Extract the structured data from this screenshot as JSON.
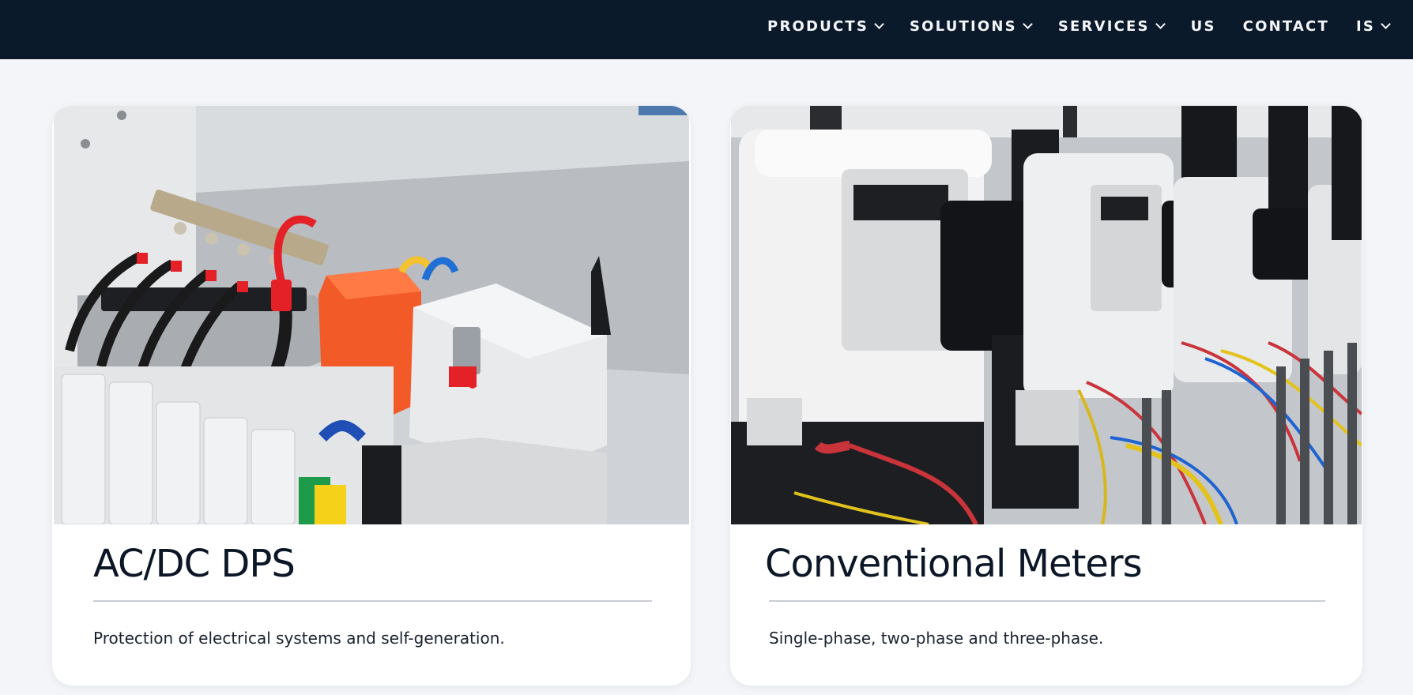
{
  "nav": {
    "items": [
      {
        "label": "PRODUCTS",
        "has_dropdown": true
      },
      {
        "label": "SOLUTIONS",
        "has_dropdown": true
      },
      {
        "label": "SERVICES",
        "has_dropdown": true
      },
      {
        "label": "US",
        "has_dropdown": false
      },
      {
        "label": "CONTACT",
        "has_dropdown": false
      },
      {
        "label": "IS",
        "has_dropdown": true
      }
    ]
  },
  "cards": [
    {
      "title": "AC/DC DPS",
      "description": "Protection of electrical systems and self-generation.",
      "image": "electrical-panel-surge-protector"
    },
    {
      "title": "Conventional Meters",
      "description": "Single-phase, two-phase and three-phase.",
      "image": "electricity-meters-test-bench"
    }
  ],
  "colors": {
    "header_bg": "#0b1a2b",
    "page_bg": "#f3f5f8",
    "card_bg": "#ffffff",
    "title": "#0b1626"
  }
}
